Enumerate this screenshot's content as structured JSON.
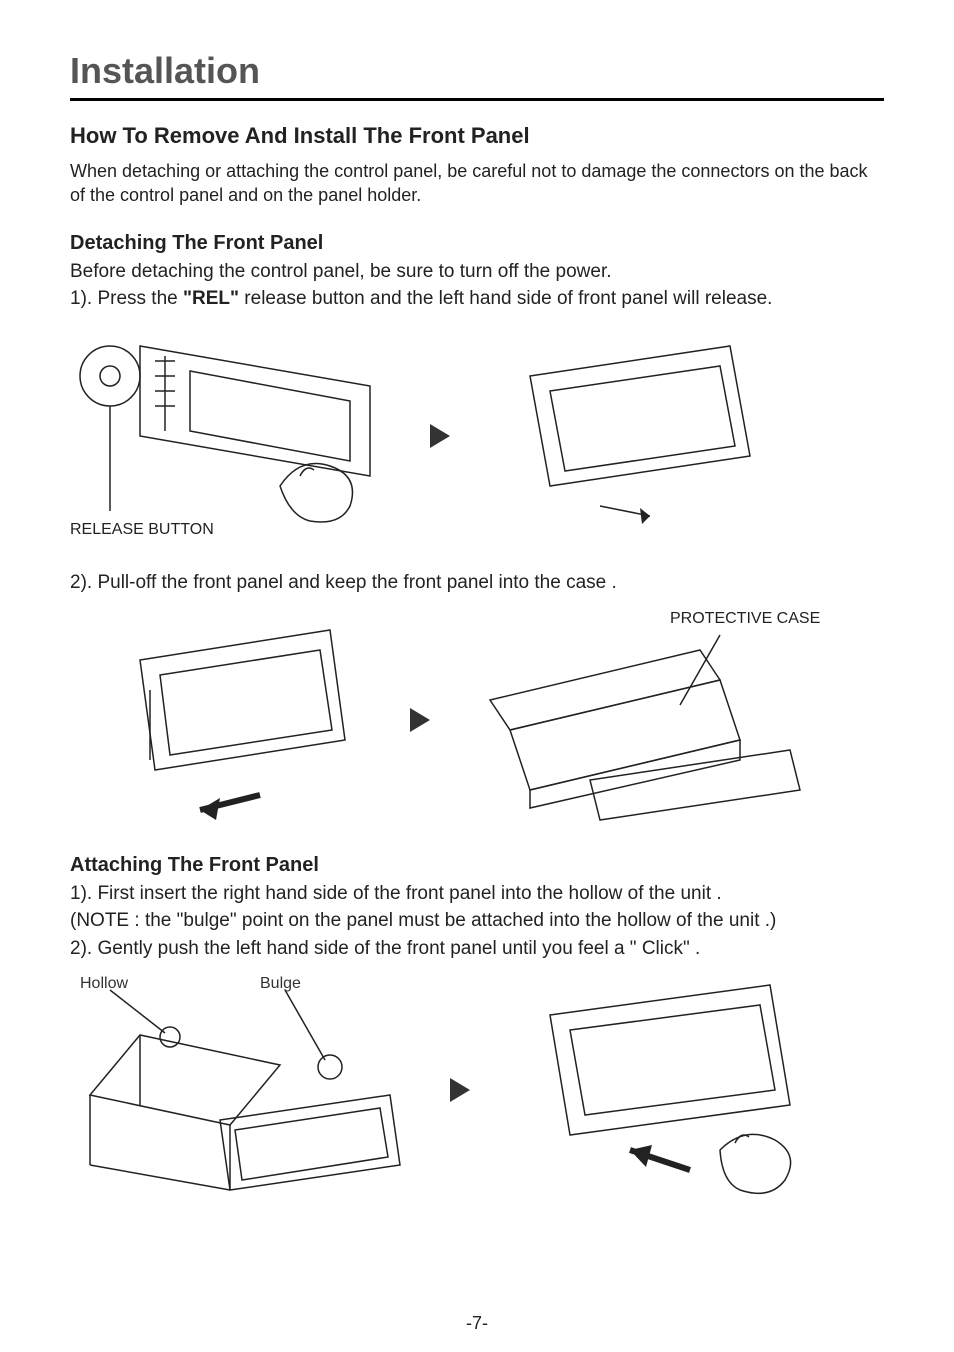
{
  "page_title": "Installation",
  "section_heading": "How To Remove And Install The Front Panel",
  "intro_text": "When detaching or attaching the control panel, be careful not to damage the connectors on the back of the control panel and on the panel holder.",
  "detach": {
    "heading": "Detaching The Front Panel",
    "intro": "Before detaching the control panel, be sure to turn off the power.",
    "step1_pre": "1). Press the ",
    "step1_bold": "\"REL\"",
    "step1_post": " release button and the left hand side of front panel will release.",
    "release_label": "RELEASE BUTTON",
    "step2": "2). Pull-off the front panel  and keep the front panel into the case .",
    "protective_case_label": "PROTECTIVE CASE"
  },
  "attach": {
    "heading": "Attaching The Front Panel",
    "step1": "1). First insert the right hand side of the front panel into the hollow of the unit .",
    "note": "(NOTE : the \"bulge\" point on the panel must be attached into the hollow of the unit .)",
    "step2": "2). Gently push the left hand side of the front panel until you feel a  \" Click\" .",
    "hollow_label": "Hollow",
    "bulge_label": "Bulge"
  },
  "footer": "-7-"
}
